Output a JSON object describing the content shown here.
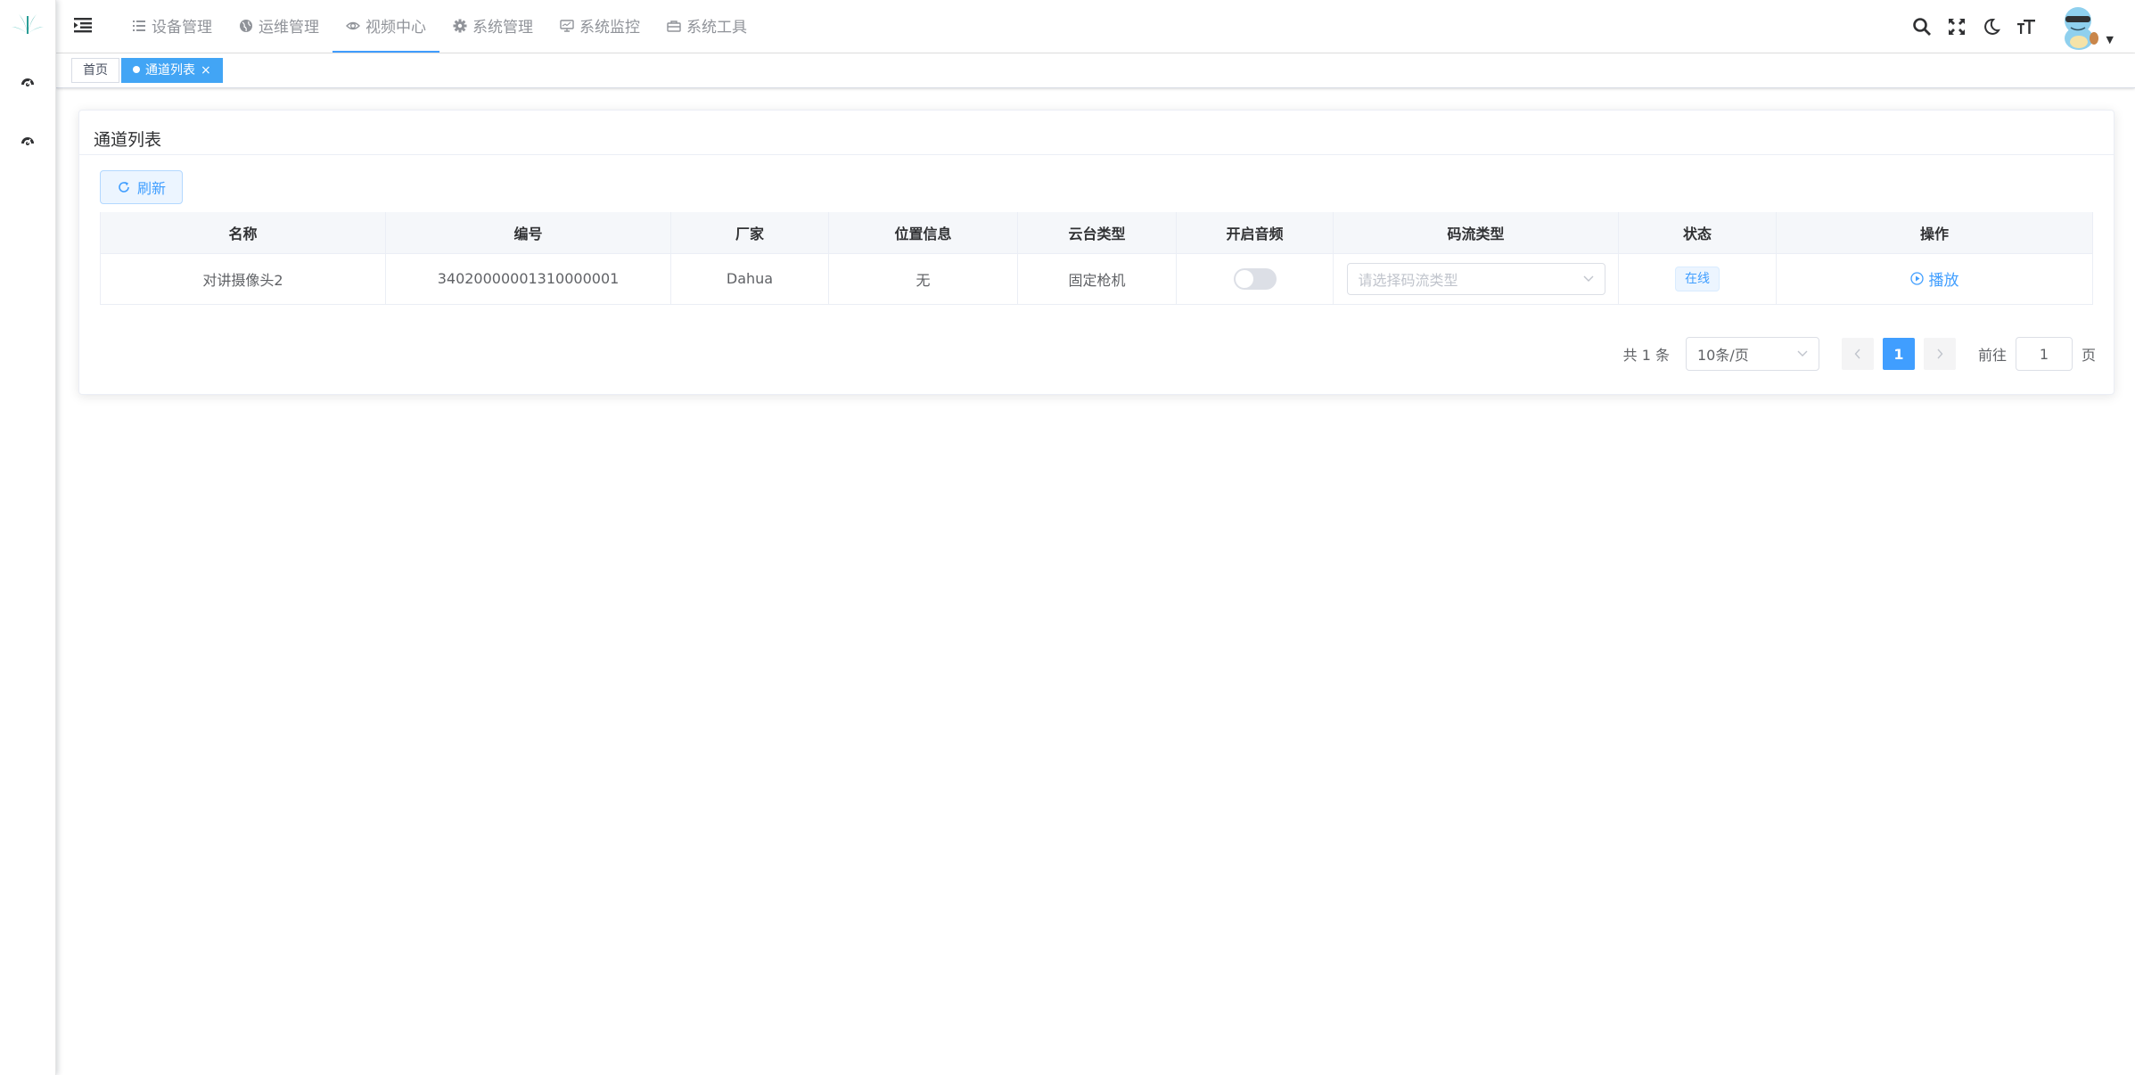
{
  "nav": {
    "menu": [
      {
        "label": "设备管理",
        "icon": "list-icon"
      },
      {
        "label": "运维管理",
        "icon": "globe-icon"
      },
      {
        "label": "视频中心",
        "icon": "eye-icon",
        "active": true
      },
      {
        "label": "系统管理",
        "icon": "gear-icon"
      },
      {
        "label": "系统监控",
        "icon": "monitor-icon"
      },
      {
        "label": "系统工具",
        "icon": "toolbox-icon"
      }
    ],
    "right_icons": [
      "search-icon",
      "fullscreen-icon",
      "moon-icon",
      "font-size-icon"
    ]
  },
  "tags": {
    "home": "首页",
    "current": "通道列表",
    "close": "×"
  },
  "card": {
    "title": "通道列表",
    "refresh": "刷新"
  },
  "table": {
    "columns": [
      "名称",
      "编号",
      "厂家",
      "位置信息",
      "云台类型",
      "开启音频",
      "码流类型",
      "状态",
      "操作"
    ],
    "rows": [
      {
        "name": "对讲摄像头2",
        "code": "34020000001310000001",
        "vendor": "Dahua",
        "location": "无",
        "ptz_type": "固定枪机",
        "audio_enabled": false,
        "stream_placeholder": "请选择码流类型",
        "status": "在线",
        "action": "播放"
      }
    ]
  },
  "pagination": {
    "total": "共 1 条",
    "page_size": "10条/页",
    "current_page": "1",
    "goto_prefix": "前往",
    "goto_value": "1",
    "goto_suffix": "页"
  },
  "colors": {
    "primary": "#409eff",
    "tag_active": "#42a5f5"
  }
}
